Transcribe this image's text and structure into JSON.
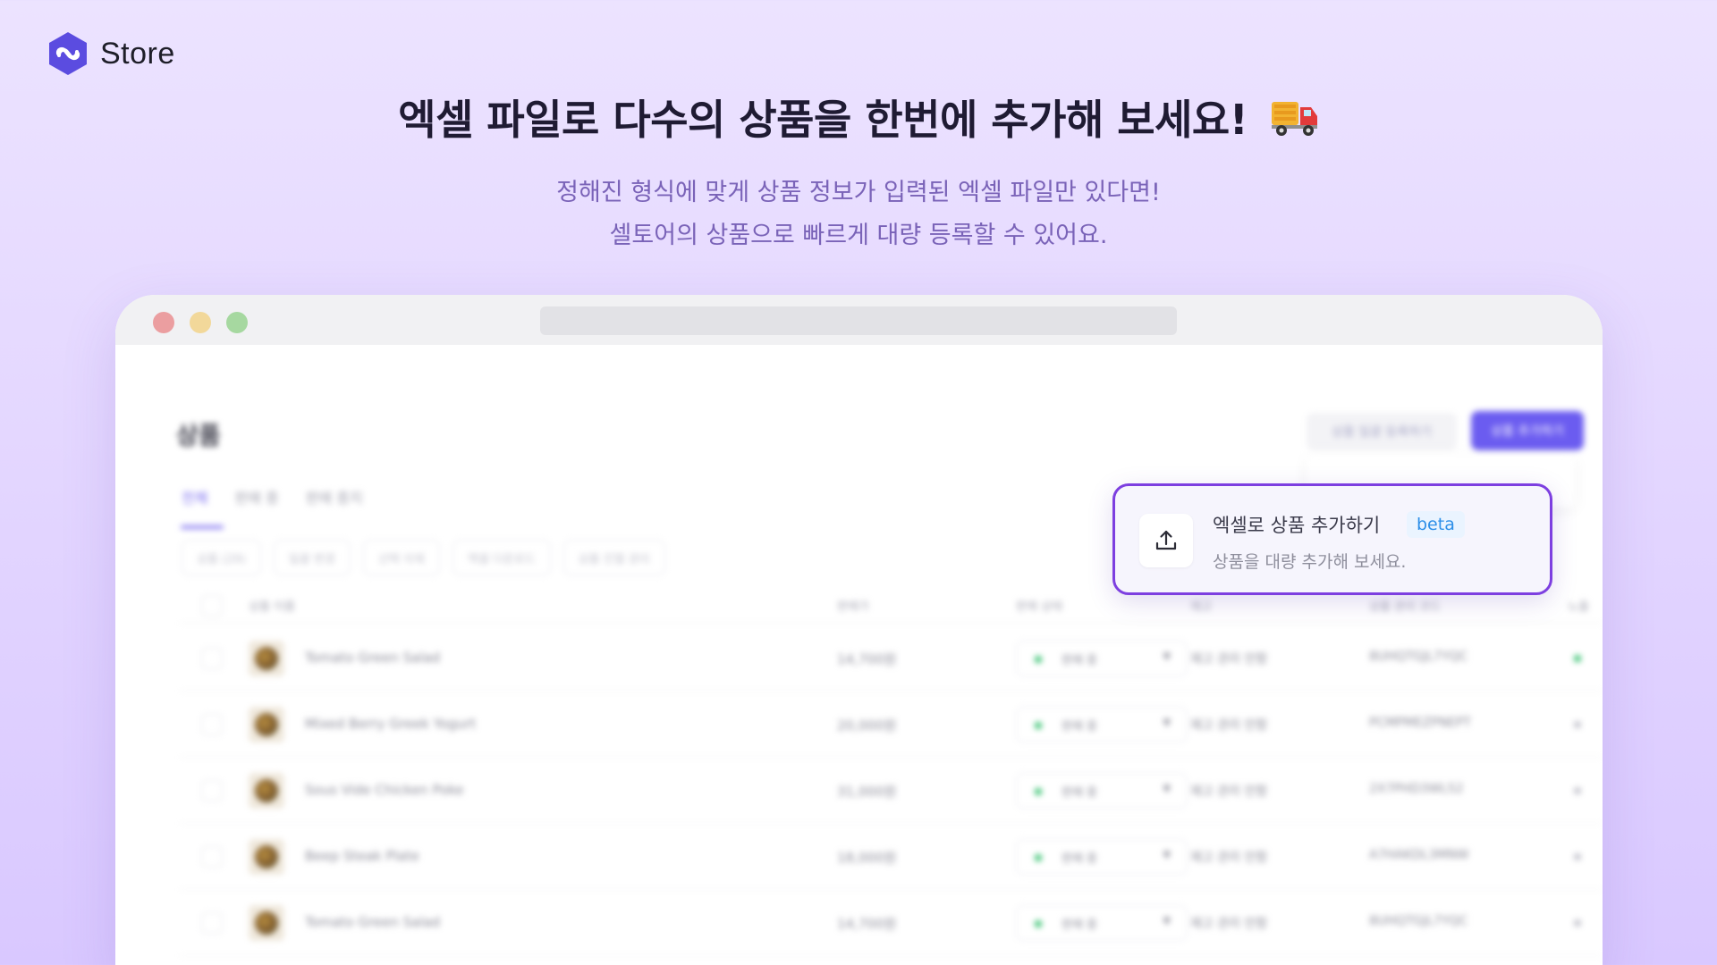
{
  "brand": {
    "name": "Store"
  },
  "hero": {
    "title": "엑셀 파일로 다수의 상품을 한번에 추가해 보세요!",
    "subtitle_line1": "정해진 형식에 맞게 상품 정보가 입력된 엑셀 파일만 있다면!",
    "subtitle_line2": "셀토어의 상품으로 빠르게 대량 등록할 수 있어요."
  },
  "app": {
    "page_title": "상품",
    "tabs": [
      "전체",
      "판매 중",
      "판매 중지"
    ],
    "buttons": {
      "bulk": "상품 일괄 등록하기",
      "add": "상품 추가하기"
    },
    "filters": [
      "상품 (29)",
      "일괄 변경",
      "선택 삭제",
      "엑셀 다운로드",
      "상품 진열 관리"
    ],
    "columns": [
      "상품 이름",
      "판매가",
      "판매 상태",
      "재고",
      "상품 관리 코드",
      "노출"
    ],
    "rows": [
      {
        "name": "Tomato Green Salad",
        "price": "14,700원",
        "status": "판매 중",
        "stock": "재고 관리 안함",
        "code": "8UHQTGJL7YQC",
        "visible": true
      },
      {
        "name": "Mixed Berry Greek Yogurt",
        "price": "20,000원",
        "status": "판매 중",
        "stock": "재고 관리 안함",
        "code": "PCMPMEZPNEPT",
        "visible": false
      },
      {
        "name": "Sous Vide Chicken Poke",
        "price": "31,000원",
        "status": "판매 중",
        "stock": "재고 관리 안함",
        "code": "2X7PHD3WL52",
        "visible": false
      },
      {
        "name": "Beep Steak Plate",
        "price": "18,000원",
        "status": "판매 중",
        "stock": "재고 관리 안함",
        "code": "A7HAKDL3MNW",
        "visible": false
      },
      {
        "name": "Tomato Green Salad",
        "price": "14,700원",
        "status": "판매 중",
        "stock": "재고 관리 안함",
        "code": "8UHQTGJL7YQC",
        "visible": false
      }
    ]
  },
  "popover": {
    "title": "엑셀로 상품 추가하기",
    "badge": "beta",
    "description": "상품을 대량 추가해 보세요.",
    "icon": "upload-icon"
  },
  "colors": {
    "accent": "#6b5cf0",
    "highlight_border": "#7d3fe0",
    "badge_text": "#2d8fe8"
  }
}
